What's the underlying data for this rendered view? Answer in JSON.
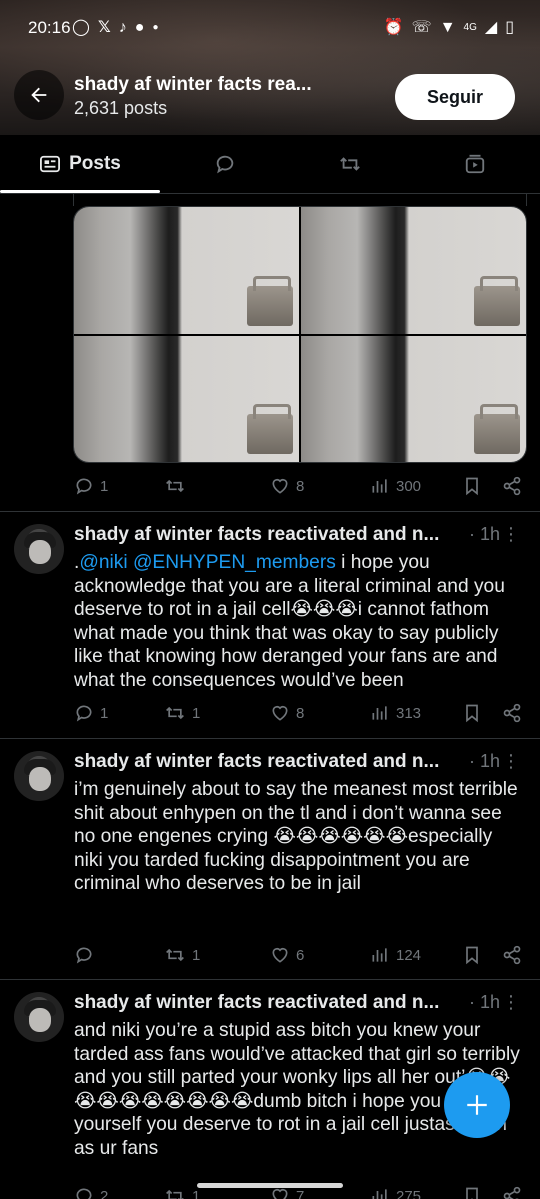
{
  "status_bar": {
    "time": "20:16",
    "network": "4G"
  },
  "header": {
    "profile_name": "shady af winter facts rea...",
    "post_count": "2,631 posts",
    "follow_label": "Seguir"
  },
  "tabs": {
    "posts_label": "Posts"
  },
  "tweet0": {
    "replies": "1",
    "reposts": "",
    "likes": "8",
    "views": "300"
  },
  "tweets": [
    {
      "author": "shady af winter facts reactivated and n...",
      "time": "· 1h",
      "mention_prefix": ".",
      "mentions": "@niki @ENHYPEN_members",
      "text": " i hope you acknowledge that you are a literal criminal and you deserve to rot in a jail cell😭😭😭i cannot fathom what made you think that was okay to say publicly like that knowing how deranged your fans are and what the consequences would’ve been",
      "replies": "1",
      "reposts": "1",
      "likes": "8",
      "views": "313"
    },
    {
      "author": "shady af winter facts reactivated and n...",
      "time": "· 1h",
      "text": "i’m genuinely about to say the meanest most terrible shit about enhypen on the tl and i don’t wanna see no one engenes crying 😭😭😭😭😭😭especially niki you tarded fucking disappointment you are criminal who deserves to be in jail",
      "replies": "",
      "reposts": "1",
      "likes": "6",
      "views": "124"
    },
    {
      "author": "shady af winter facts reactivated and n...",
      "time": "· 1h",
      "text": "and niki you’re a stupid ass bitch you knew your tarded ass fans would’ve attacked that girl so terribly and you still parted your wonky lips all her out’😭😭😭😭😭😭😭😭😭😭dumb bitch i hope you blame yourself you deserve to rot in a jail cell justas much as ur fans",
      "replies": "2",
      "reposts": "1",
      "likes": "7",
      "views": "275"
    }
  ]
}
